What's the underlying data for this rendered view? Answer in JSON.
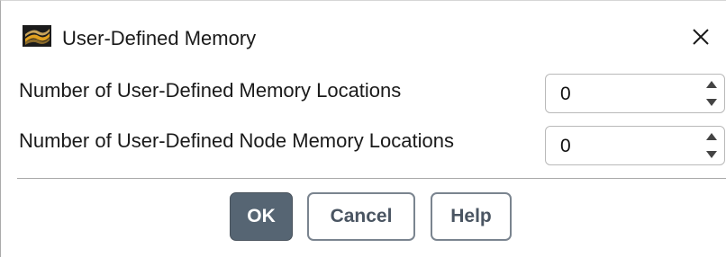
{
  "window": {
    "title": "User-Defined Memory",
    "app_icon": "fluent-logo-icon",
    "close_icon": "close-icon"
  },
  "fields": [
    {
      "label": "Number of User-Defined Memory Locations",
      "value": "0"
    },
    {
      "label": "Number of User-Defined Node Memory Locations",
      "value": "0"
    }
  ],
  "buttons": {
    "ok": "OK",
    "cancel": "Cancel",
    "help": "Help"
  },
  "colors": {
    "ok_button_bg": "#566573",
    "secondary_button_text": "#4a5562",
    "spinner_arrow": "#444444"
  }
}
